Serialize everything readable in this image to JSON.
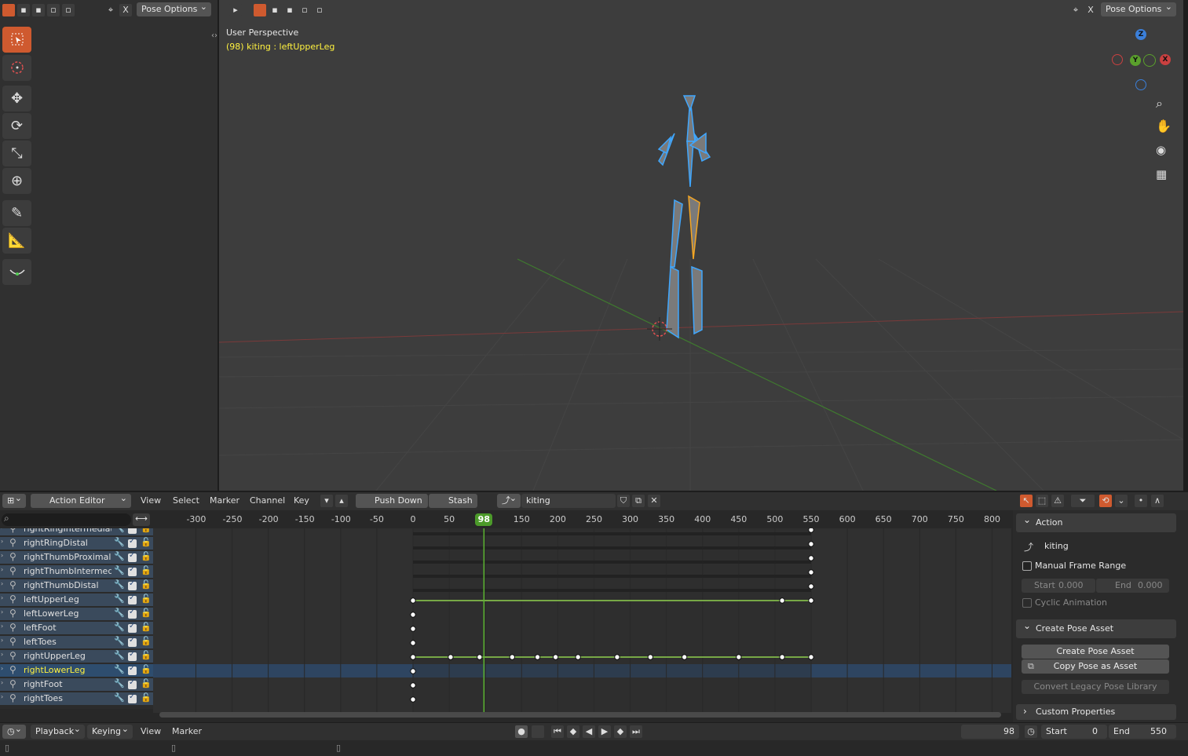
{
  "top_header": {
    "pose_options_left": "Pose Options",
    "pose_options_right": "Pose Options",
    "close_label": "X"
  },
  "viewport": {
    "view_name": "User Perspective",
    "object_info": "(98) kiting : leftUpperLeg",
    "gizmo": {
      "z": "Z",
      "y": "Y",
      "x": "X"
    },
    "colors": {
      "bone_blue": "#3fa7ff",
      "bone_selected": "#f5a623",
      "x_axis": "#c94040",
      "y_axis": "#5aa02c",
      "z_axis": "#3b7fd9"
    }
  },
  "tools": [
    "select-box",
    "cursor",
    "move",
    "rotate",
    "scale",
    "transform",
    "annotate",
    "measure",
    "relax-pose"
  ],
  "action_editor": {
    "editor_type": "Action Editor",
    "menus": [
      "View",
      "Select",
      "Marker",
      "Channel",
      "Key"
    ],
    "push_down": "Push Down",
    "stash": "Stash",
    "action_name": "kiting",
    "ruler_ticks": [
      "-300",
      "-250",
      "-200",
      "-150",
      "-100",
      "-50",
      "0",
      "50",
      "98",
      "150",
      "200",
      "250",
      "300",
      "350",
      "400",
      "450",
      "500",
      "550",
      "600",
      "650",
      "700",
      "750",
      "800"
    ],
    "current_frame": "98",
    "channels": [
      {
        "name": "rightRingIntermediate",
        "selected": false
      },
      {
        "name": "rightRingDistal",
        "selected": false
      },
      {
        "name": "rightThumbProximal",
        "selected": false
      },
      {
        "name": "rightThumbIntermedi",
        "selected": false
      },
      {
        "name": "rightThumbDistal",
        "selected": false
      },
      {
        "name": "leftUpperLeg",
        "selected": false
      },
      {
        "name": "leftLowerLeg",
        "selected": false
      },
      {
        "name": "leftFoot",
        "selected": false
      },
      {
        "name": "leftToes",
        "selected": false
      },
      {
        "name": "rightUpperLeg",
        "selected": false
      },
      {
        "name": "rightLowerLeg",
        "selected": true
      },
      {
        "name": "rightFoot",
        "selected": false
      },
      {
        "name": "rightToes",
        "selected": false
      }
    ]
  },
  "sidebar": {
    "action_panel": "Action",
    "action_name": "kiting",
    "manual_frame_range": "Manual Frame Range",
    "start_label": "Start",
    "start_value": "0.000",
    "end_label": "End",
    "end_value": "0.000",
    "cyclic_animation": "Cyclic Animation",
    "create_pose_asset_panel": "Create Pose Asset",
    "create_pose_asset_button": "Create Pose Asset",
    "copy_pose_as_asset_button": "Copy Pose as Asset",
    "convert_legacy_button": "Convert Legacy Pose Library",
    "custom_properties_panel": "Custom Properties"
  },
  "timeline": {
    "playback": "Playback",
    "keying": "Keying",
    "view": "View",
    "marker": "Marker",
    "current_frame": "98",
    "start_label": "Start",
    "start_value": "0",
    "end_label": "End",
    "end_value": "550"
  }
}
